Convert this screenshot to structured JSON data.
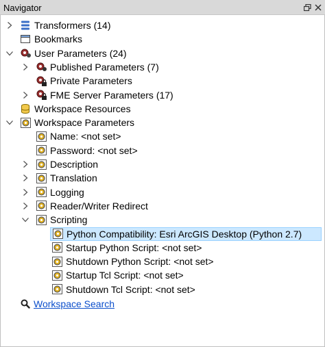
{
  "panel": {
    "title": "Navigator",
    "float_icon": "restore-window-icon",
    "close_icon": "close-icon"
  },
  "tree": [
    {
      "label": "Transformers (14)",
      "icon": "transformers-icon",
      "expander": "collapsed"
    },
    {
      "label": "Bookmarks",
      "icon": "bookmark-icon",
      "expander": "none"
    },
    {
      "label": "User Parameters (24)",
      "icon": "user-parameters-icon",
      "expander": "expanded"
    },
    {
      "label": "Published Parameters (7)",
      "icon": "published-parameters-icon",
      "expander": "collapsed"
    },
    {
      "label": "Private Parameters",
      "icon": "private-parameters-icon",
      "expander": "none"
    },
    {
      "label": "FME Server Parameters (17)",
      "icon": "server-parameters-icon",
      "expander": "collapsed"
    },
    {
      "label": "Workspace Resources",
      "icon": "database-icon",
      "expander": "none"
    },
    {
      "label": "Workspace Parameters",
      "icon": "workspace-parameters-icon",
      "expander": "expanded"
    },
    {
      "label": "Name: <not set>",
      "icon": "parameter-icon",
      "expander": "none"
    },
    {
      "label": "Password: <not set>",
      "icon": "parameter-icon",
      "expander": "none"
    },
    {
      "label": "Description",
      "icon": "parameter-icon",
      "expander": "collapsed"
    },
    {
      "label": "Translation",
      "icon": "parameter-icon",
      "expander": "collapsed"
    },
    {
      "label": "Logging",
      "icon": "parameter-icon",
      "expander": "collapsed"
    },
    {
      "label": "Reader/Writer Redirect",
      "icon": "parameter-icon",
      "expander": "collapsed"
    },
    {
      "label": "Scripting",
      "icon": "parameter-icon",
      "expander": "expanded"
    },
    {
      "label": "Python Compatibility: Esri ArcGIS Desktop (Python 2.7)",
      "icon": "parameter-icon",
      "expander": "none",
      "selected": true
    },
    {
      "label": "Startup Python Script: <not set>",
      "icon": "parameter-icon",
      "expander": "none"
    },
    {
      "label": "Shutdown Python Script: <not set>",
      "icon": "parameter-icon",
      "expander": "none"
    },
    {
      "label": "Startup Tcl Script: <not set>",
      "icon": "parameter-icon",
      "expander": "none"
    },
    {
      "label": "Shutdown Tcl Script: <not set>",
      "icon": "parameter-icon",
      "expander": "none"
    }
  ],
  "search": {
    "label": "Workspace Search",
    "icon": "search-icon"
  },
  "colors": {
    "selection_bg": "#cce8ff",
    "selection_border": "#99d1ff",
    "link": "#0b4ecb",
    "titlebar": "#d9d9d9"
  }
}
